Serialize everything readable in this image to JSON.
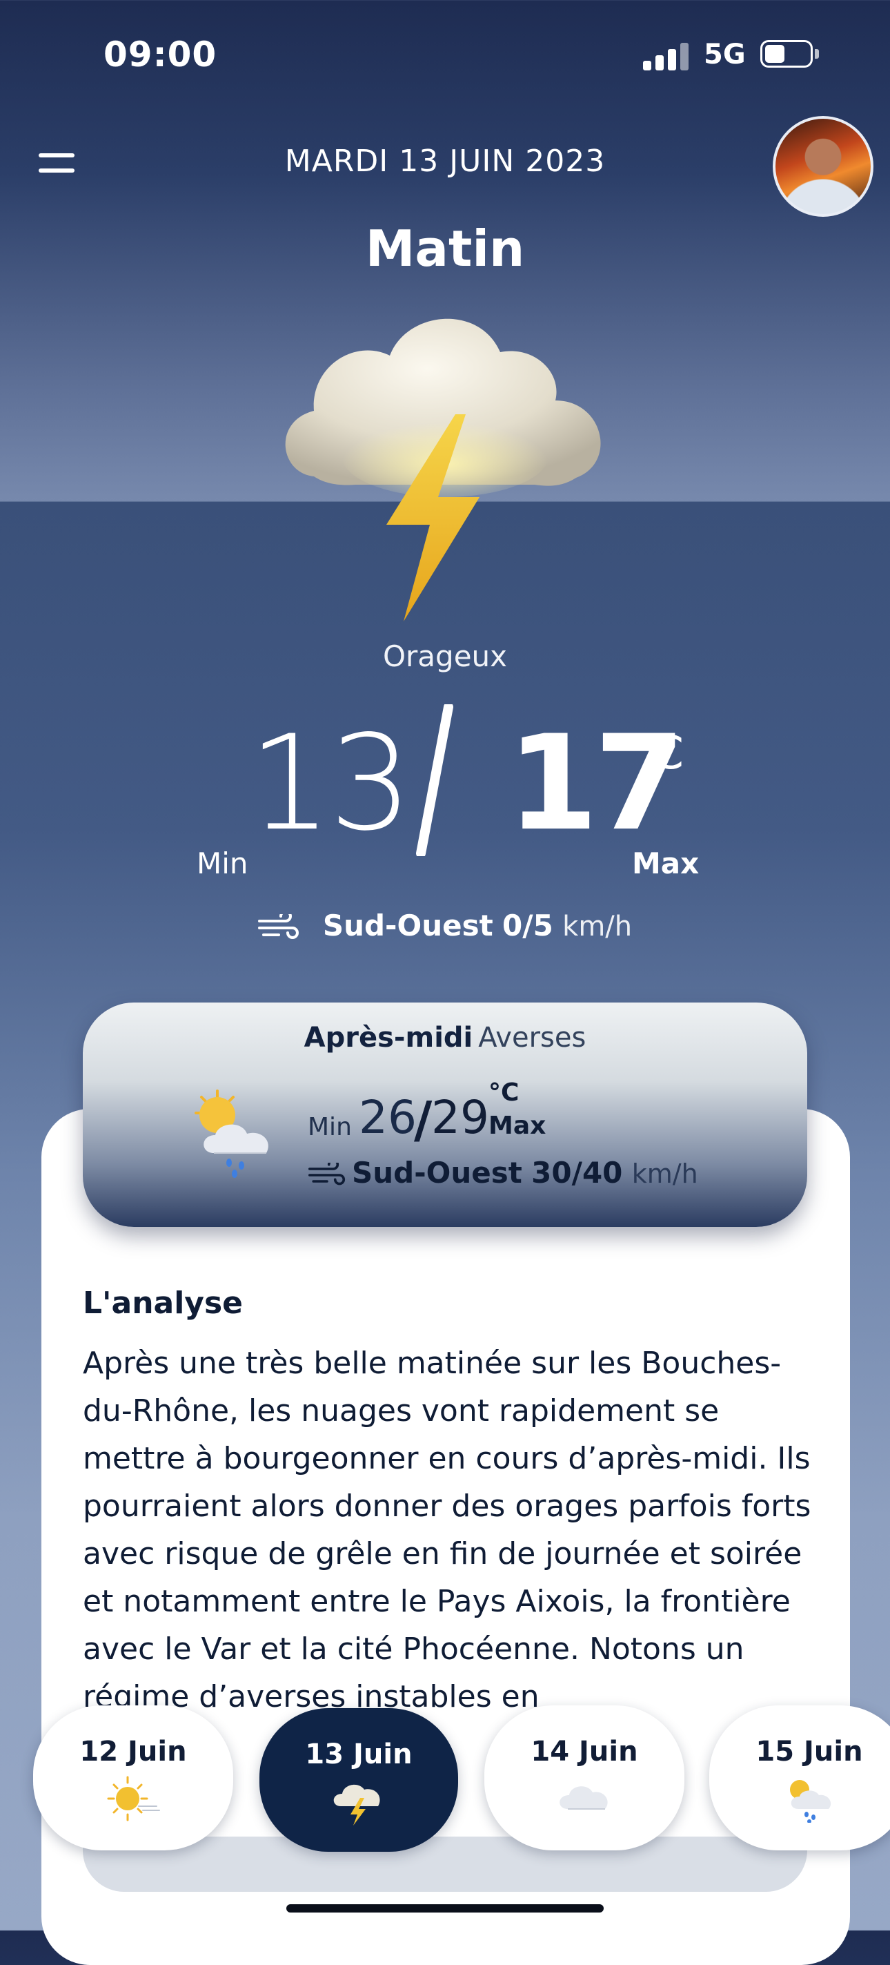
{
  "status": {
    "time": "09:00",
    "network": "5G",
    "battery_level": 0.35
  },
  "header": {
    "date": "MARDI 13 JUIN 2023",
    "period": "Matin"
  },
  "current": {
    "icon": "storm-cloud-icon",
    "condition": "Orageux",
    "temp_min": "13",
    "temp_max": "17",
    "unit": "°C",
    "min_label": "Min",
    "max_label": "Max",
    "wind_direction": "Sud-Ouest",
    "wind_speed": "0/5",
    "wind_unit": "km/h"
  },
  "afternoon": {
    "title": "Après-midi",
    "condition": "Averses",
    "icon": "sun-cloud-rain-icon",
    "min_label": "Min",
    "temp_min": "26",
    "temp_max": "29",
    "unit": "°C",
    "max_label": "Max",
    "wind_direction": "Sud-Ouest",
    "wind_speed": "30/40",
    "wind_unit": "km/h"
  },
  "analysis": {
    "title": "L'analyse",
    "text": "Après une très belle matinée sur les Bouches-du-Rhône, les nuages vont rapidement se mettre à bourgeonner en cours d’après-midi. Ils pourraient alors donner des orages parfois forts avec risque de grêle en fin de journée et soirée et notamment entre le Pays Aixois, la frontière avec le Var et la cité Phocéenne. Notons un régime d’averses instables en"
  },
  "days": [
    {
      "label": "12 Juin",
      "icon": "sun-icon",
      "active": false
    },
    {
      "label": "13 Juin",
      "icon": "storm-cloud-icon",
      "active": true
    },
    {
      "label": "14 Juin",
      "icon": "cloud-icon",
      "active": false
    },
    {
      "label": "15 Juin",
      "icon": "sun-cloud-rain-icon",
      "active": false
    }
  ],
  "colors": {
    "navy": "#0f2447",
    "text_dark": "#0f1c35",
    "bolt": "#f2c230"
  }
}
